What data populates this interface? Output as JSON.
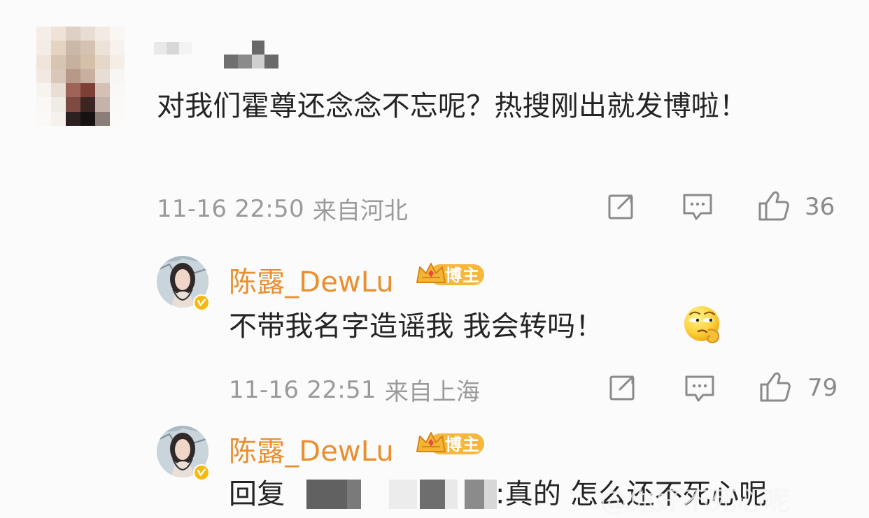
{
  "comment": {
    "text": "对我们霍尊还念念不忘呢？热搜刚出就发博啦！",
    "time": "11-16 22:50",
    "location": "来自河北",
    "likes": "36"
  },
  "reply_one": {
    "name": "陈露_DewLu",
    "badge": "博主",
    "text": "不带我名字造谣我 我会转吗！",
    "time": "11-16 22:51",
    "location": "来自上海",
    "likes": "79"
  },
  "reply_two": {
    "name": "陈露_DewLu",
    "badge": "博主",
    "prefix": "回复",
    "text": ":真的 怎么还不死心呢"
  },
  "watermark": "@你好不死心呢",
  "icons": {
    "share": "share-icon",
    "comment": "comment-icon",
    "like": "like-icon",
    "badge_crown": "crown-icon",
    "verified": "verified-icon",
    "emoji": "thinking-face-icon"
  },
  "colors": {
    "name": "#e98f2f",
    "badge": "#f6b73c",
    "text": "#242424",
    "meta": "#9a9a9a",
    "icon": "#8a8a8a"
  }
}
